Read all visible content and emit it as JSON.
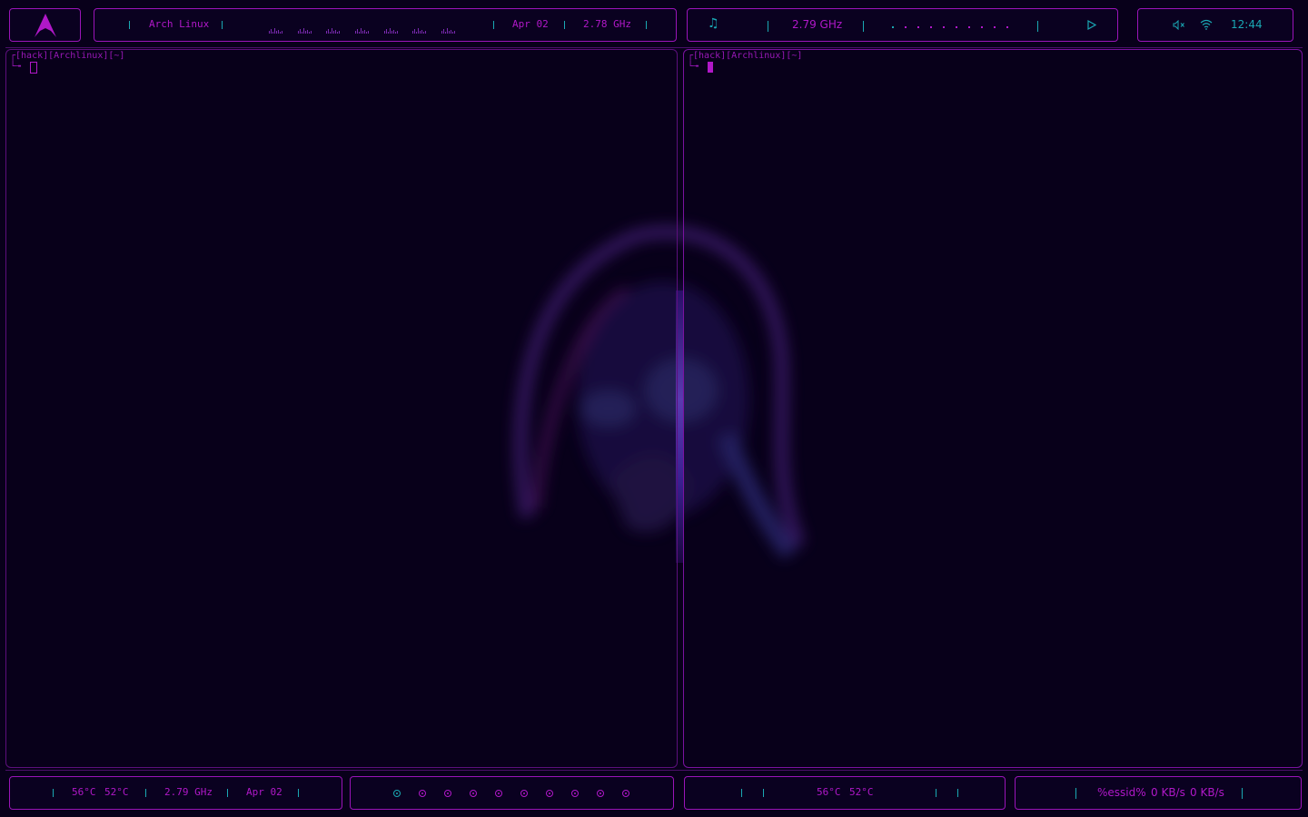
{
  "colors": {
    "accent": "#b018c8",
    "secondary": "#1aa8b4",
    "background": "#08001a",
    "border": "#9a14b8"
  },
  "top_left_bar": {
    "logo_icon": "arch-logo-icon",
    "distro": "Arch Linux",
    "date": "Apr 02",
    "cpu_freq": "2.78 GHz"
  },
  "top_media_bar": {
    "music_icon": "music-note-icon",
    "cpu_freq": "2.79 GHz",
    "play_icon": "play-icon"
  },
  "top_right_bar": {
    "volume_icon": "volume-muted-icon",
    "wifi_icon": "wifi-icon",
    "clock": "12:44"
  },
  "terminals": {
    "left": {
      "prompt_line1": "┌[hack][Archlinux][~]",
      "prompt_line2": "└╼"
    },
    "right": {
      "prompt_line1": "┌[hack][Archlinux][~]",
      "prompt_line2": "└╼"
    }
  },
  "bottom_left_bar": {
    "temp1": "56°C",
    "temp2": "52°C",
    "cpu_freq": "2.79 GHz",
    "date": "Apr 02"
  },
  "bottom_workspaces": {
    "count": 10,
    "active_index": 0
  },
  "bottom_mid_bar": {
    "temp1": "56°C",
    "temp2": "52°C"
  },
  "bottom_right_bar": {
    "essid": "%essid%",
    "down": "0 KB/s",
    "up": "0 KB/s"
  }
}
